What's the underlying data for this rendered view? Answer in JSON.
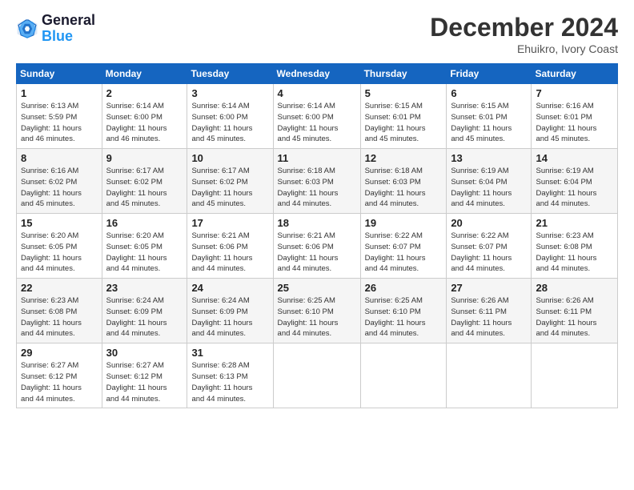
{
  "header": {
    "logo_line1": "General",
    "logo_line2": "Blue",
    "month": "December 2024",
    "location": "Ehuikro, Ivory Coast"
  },
  "days_of_week": [
    "Sunday",
    "Monday",
    "Tuesday",
    "Wednesday",
    "Thursday",
    "Friday",
    "Saturday"
  ],
  "weeks": [
    [
      {
        "day": 1,
        "info": "Sunrise: 6:13 AM\nSunset: 5:59 PM\nDaylight: 11 hours\nand 46 minutes."
      },
      {
        "day": 2,
        "info": "Sunrise: 6:14 AM\nSunset: 6:00 PM\nDaylight: 11 hours\nand 46 minutes."
      },
      {
        "day": 3,
        "info": "Sunrise: 6:14 AM\nSunset: 6:00 PM\nDaylight: 11 hours\nand 45 minutes."
      },
      {
        "day": 4,
        "info": "Sunrise: 6:14 AM\nSunset: 6:00 PM\nDaylight: 11 hours\nand 45 minutes."
      },
      {
        "day": 5,
        "info": "Sunrise: 6:15 AM\nSunset: 6:01 PM\nDaylight: 11 hours\nand 45 minutes."
      },
      {
        "day": 6,
        "info": "Sunrise: 6:15 AM\nSunset: 6:01 PM\nDaylight: 11 hours\nand 45 minutes."
      },
      {
        "day": 7,
        "info": "Sunrise: 6:16 AM\nSunset: 6:01 PM\nDaylight: 11 hours\nand 45 minutes."
      }
    ],
    [
      {
        "day": 8,
        "info": "Sunrise: 6:16 AM\nSunset: 6:02 PM\nDaylight: 11 hours\nand 45 minutes."
      },
      {
        "day": 9,
        "info": "Sunrise: 6:17 AM\nSunset: 6:02 PM\nDaylight: 11 hours\nand 45 minutes."
      },
      {
        "day": 10,
        "info": "Sunrise: 6:17 AM\nSunset: 6:02 PM\nDaylight: 11 hours\nand 45 minutes."
      },
      {
        "day": 11,
        "info": "Sunrise: 6:18 AM\nSunset: 6:03 PM\nDaylight: 11 hours\nand 44 minutes."
      },
      {
        "day": 12,
        "info": "Sunrise: 6:18 AM\nSunset: 6:03 PM\nDaylight: 11 hours\nand 44 minutes."
      },
      {
        "day": 13,
        "info": "Sunrise: 6:19 AM\nSunset: 6:04 PM\nDaylight: 11 hours\nand 44 minutes."
      },
      {
        "day": 14,
        "info": "Sunrise: 6:19 AM\nSunset: 6:04 PM\nDaylight: 11 hours\nand 44 minutes."
      }
    ],
    [
      {
        "day": 15,
        "info": "Sunrise: 6:20 AM\nSunset: 6:05 PM\nDaylight: 11 hours\nand 44 minutes."
      },
      {
        "day": 16,
        "info": "Sunrise: 6:20 AM\nSunset: 6:05 PM\nDaylight: 11 hours\nand 44 minutes."
      },
      {
        "day": 17,
        "info": "Sunrise: 6:21 AM\nSunset: 6:06 PM\nDaylight: 11 hours\nand 44 minutes."
      },
      {
        "day": 18,
        "info": "Sunrise: 6:21 AM\nSunset: 6:06 PM\nDaylight: 11 hours\nand 44 minutes."
      },
      {
        "day": 19,
        "info": "Sunrise: 6:22 AM\nSunset: 6:07 PM\nDaylight: 11 hours\nand 44 minutes."
      },
      {
        "day": 20,
        "info": "Sunrise: 6:22 AM\nSunset: 6:07 PM\nDaylight: 11 hours\nand 44 minutes."
      },
      {
        "day": 21,
        "info": "Sunrise: 6:23 AM\nSunset: 6:08 PM\nDaylight: 11 hours\nand 44 minutes."
      }
    ],
    [
      {
        "day": 22,
        "info": "Sunrise: 6:23 AM\nSunset: 6:08 PM\nDaylight: 11 hours\nand 44 minutes."
      },
      {
        "day": 23,
        "info": "Sunrise: 6:24 AM\nSunset: 6:09 PM\nDaylight: 11 hours\nand 44 minutes."
      },
      {
        "day": 24,
        "info": "Sunrise: 6:24 AM\nSunset: 6:09 PM\nDaylight: 11 hours\nand 44 minutes."
      },
      {
        "day": 25,
        "info": "Sunrise: 6:25 AM\nSunset: 6:10 PM\nDaylight: 11 hours\nand 44 minutes."
      },
      {
        "day": 26,
        "info": "Sunrise: 6:25 AM\nSunset: 6:10 PM\nDaylight: 11 hours\nand 44 minutes."
      },
      {
        "day": 27,
        "info": "Sunrise: 6:26 AM\nSunset: 6:11 PM\nDaylight: 11 hours\nand 44 minutes."
      },
      {
        "day": 28,
        "info": "Sunrise: 6:26 AM\nSunset: 6:11 PM\nDaylight: 11 hours\nand 44 minutes."
      }
    ],
    [
      {
        "day": 29,
        "info": "Sunrise: 6:27 AM\nSunset: 6:12 PM\nDaylight: 11 hours\nand 44 minutes."
      },
      {
        "day": 30,
        "info": "Sunrise: 6:27 AM\nSunset: 6:12 PM\nDaylight: 11 hours\nand 44 minutes."
      },
      {
        "day": 31,
        "info": "Sunrise: 6:28 AM\nSunset: 6:13 PM\nDaylight: 11 hours\nand 44 minutes."
      },
      null,
      null,
      null,
      null
    ]
  ]
}
